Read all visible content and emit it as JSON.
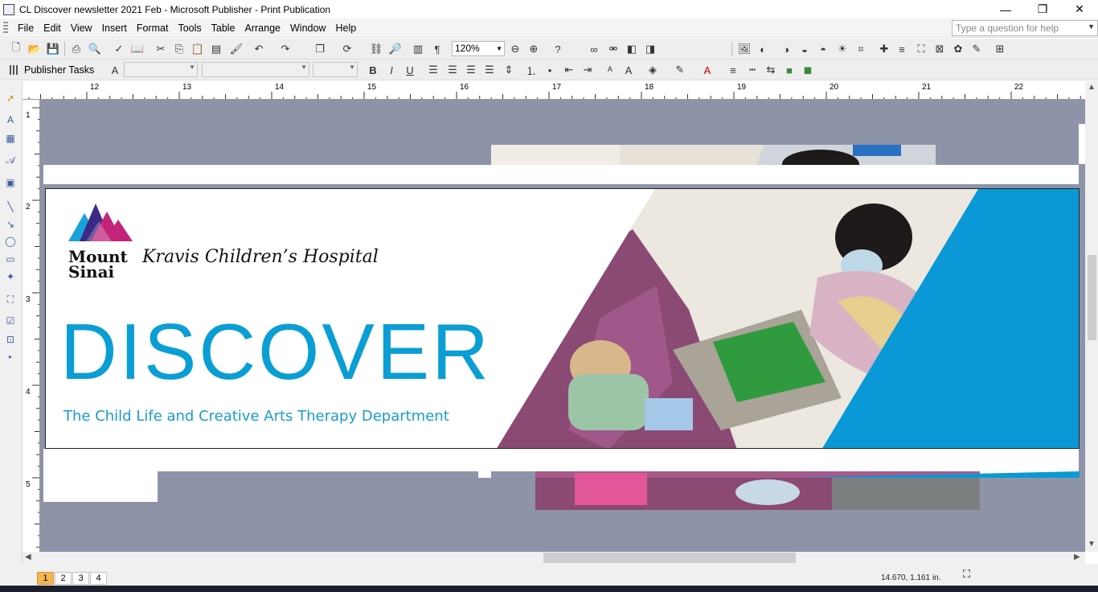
{
  "window": {
    "title": "CL Discover newsletter 2021 Feb - Microsoft Publisher - Print Publication",
    "controls": [
      "—",
      "❐",
      "✕"
    ]
  },
  "menu": {
    "items": [
      "File",
      "Edit",
      "View",
      "Insert",
      "Format",
      "Tools",
      "Table",
      "Arrange",
      "Window",
      "Help"
    ],
    "help_placeholder": "Type a question for help"
  },
  "toolbar": {
    "zoom": "120%",
    "publisher_tasks": "Publisher Tasks",
    "bold": "B",
    "italic": "I",
    "underline": "U"
  },
  "ruler": {
    "top_labels": [
      "12",
      "13",
      "14",
      "15",
      "16",
      "17",
      "18",
      "19",
      "20",
      "21",
      "22"
    ],
    "left_labels": [
      "1",
      "2",
      "3",
      "4",
      "5"
    ]
  },
  "banner": {
    "logo_mount": "Mount",
    "logo_sinai": "Sinai",
    "hospital": "Kravis Children’s Hospital",
    "headline": "DISCOVER",
    "department": "The Child Life and Creative Arts Therapy Department",
    "colors": {
      "discover_blue": "#0a9ed4",
      "panel_blue": "#0a99d6",
      "logo_magenta": "#c2247a",
      "logo_purple": "#3a2a86"
    }
  },
  "status": {
    "pages": [
      "1",
      "2",
      "3",
      "4"
    ],
    "active_page": "1",
    "coordinates": "14.670, 1.161 in."
  }
}
